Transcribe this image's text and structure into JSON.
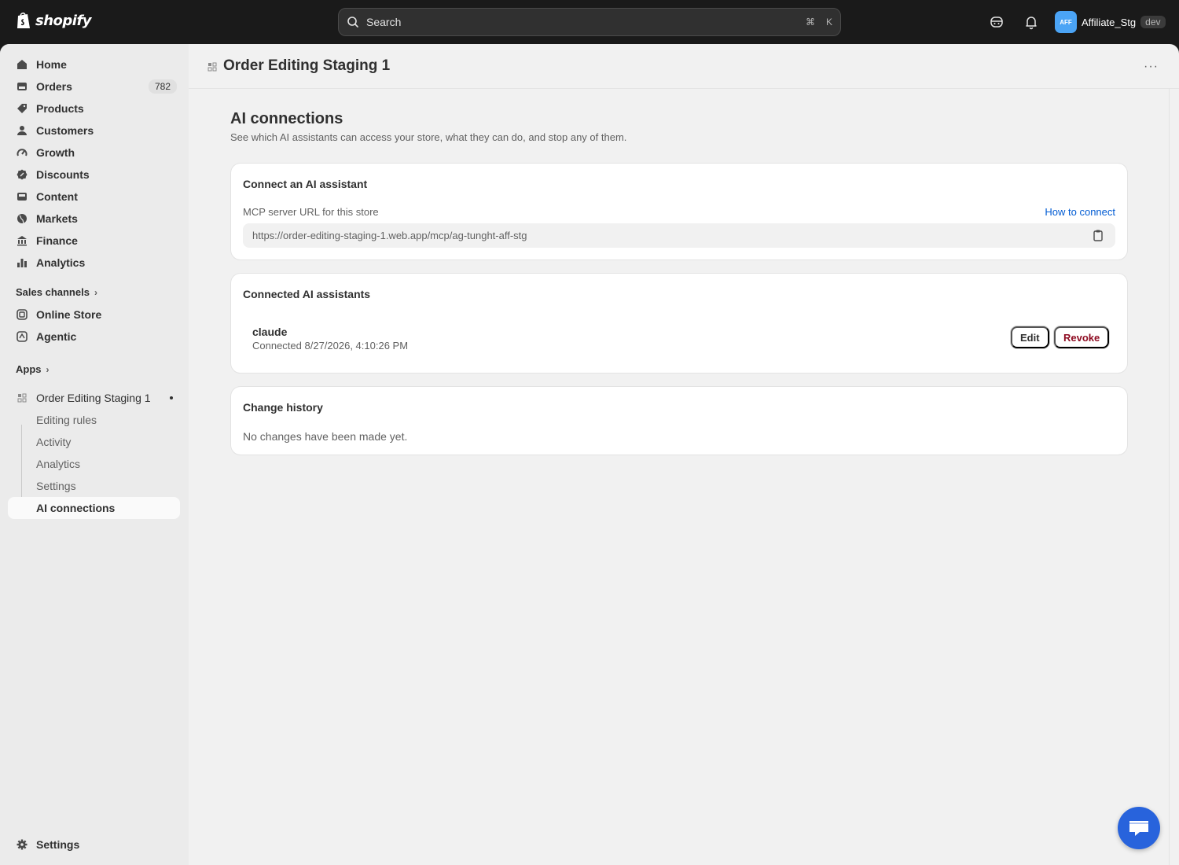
{
  "topbar": {
    "brand": "shopify",
    "search_placeholder": "Search",
    "shortcut_cmd": "⌘",
    "shortcut_key": "K",
    "avatar_initials": "AFF",
    "store_name": "Affiliate_Stg",
    "env_badge": "dev"
  },
  "sidebar": {
    "nav": [
      {
        "label": "Home",
        "icon": "home-icon"
      },
      {
        "label": "Orders",
        "icon": "orders-icon",
        "count": "782"
      },
      {
        "label": "Products",
        "icon": "tag-icon"
      },
      {
        "label": "Customers",
        "icon": "person-icon"
      },
      {
        "label": "Growth",
        "icon": "gauge-icon"
      },
      {
        "label": "Discounts",
        "icon": "discount-icon"
      },
      {
        "label": "Content",
        "icon": "content-icon"
      },
      {
        "label": "Markets",
        "icon": "globe-icon"
      },
      {
        "label": "Finance",
        "icon": "bank-icon"
      },
      {
        "label": "Analytics",
        "icon": "bar-chart-icon"
      }
    ],
    "sales_channels_title": "Sales channels",
    "channels": [
      {
        "label": "Online Store",
        "icon": "store-icon"
      },
      {
        "label": "Agentic",
        "icon": "agentic-icon"
      }
    ],
    "apps_title": "Apps",
    "app": {
      "label": "Order Editing Staging 1",
      "icon": "app-icon"
    },
    "app_subitems": [
      {
        "label": "Editing rules"
      },
      {
        "label": "Activity"
      },
      {
        "label": "Analytics"
      },
      {
        "label": "Settings"
      },
      {
        "label": "AI connections"
      }
    ],
    "settings_label": "Settings"
  },
  "header": {
    "app_title": "Order Editing Staging 1",
    "more_label": "···"
  },
  "page": {
    "title": "AI connections",
    "subtitle": "See which AI assistants can access your store, what they can do, and stop any of them."
  },
  "connect_card": {
    "title": "Connect an AI assistant",
    "field_label": "MCP server URL for this store",
    "help_link": "How to connect",
    "url": "https://order-editing-staging-1.web.app/mcp/ag-tunght-aff-stg"
  },
  "connected_card": {
    "title": "Connected AI assistants",
    "assistants": [
      {
        "name": "claude",
        "connected": "Connected 8/27/2026, 4:10:26 PM",
        "edit_label": "Edit",
        "revoke_label": "Revoke"
      }
    ]
  },
  "history_card": {
    "title": "Change history",
    "empty_text": "No changes have been made yet."
  },
  "colors": {
    "topbar_bg": "#1a1a1a",
    "link": "#005bd3",
    "danger": "#8e0b21",
    "avatar": "#4ba4f5",
    "chat_button": "#2863dc"
  }
}
